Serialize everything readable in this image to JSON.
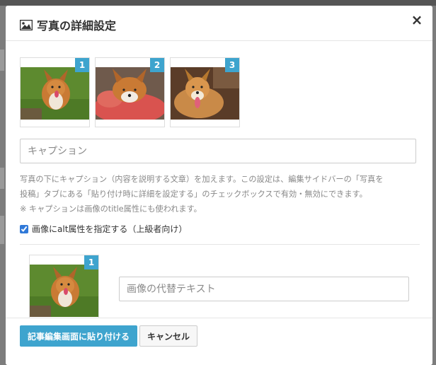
{
  "dialog": {
    "title": "写真の詳細設定",
    "close_label": "×"
  },
  "images": [
    {
      "number": "1",
      "icon": "corgi-on-grass-photo"
    },
    {
      "number": "2",
      "icon": "corgi-on-red-blanket-photo"
    },
    {
      "number": "3",
      "icon": "corgi-tongue-out-photo"
    }
  ],
  "caption": {
    "placeholder": "キャプション",
    "description_line1": "写真の下にキャプション（内容を説明する文章）を加えます。この設定は、編集サイドバーの「写真を",
    "description_line2": "投稿」タブにある「貼り付け時に詳細を設定する」のチェックボックスで有効・無効にできます。",
    "note": "※ キャプションは画像のtitle属性にも使われます。"
  },
  "alt": {
    "checkbox_label": "画像にalt属性を指定する（上級者向け）",
    "checked": true,
    "thumb_number": "1",
    "placeholder": "画像の代替テキスト"
  },
  "footer": {
    "submit_label": "記事編集画面に貼り付ける",
    "cancel_label": "キャンセル"
  },
  "colors": {
    "accent": "#3ea4ce"
  }
}
